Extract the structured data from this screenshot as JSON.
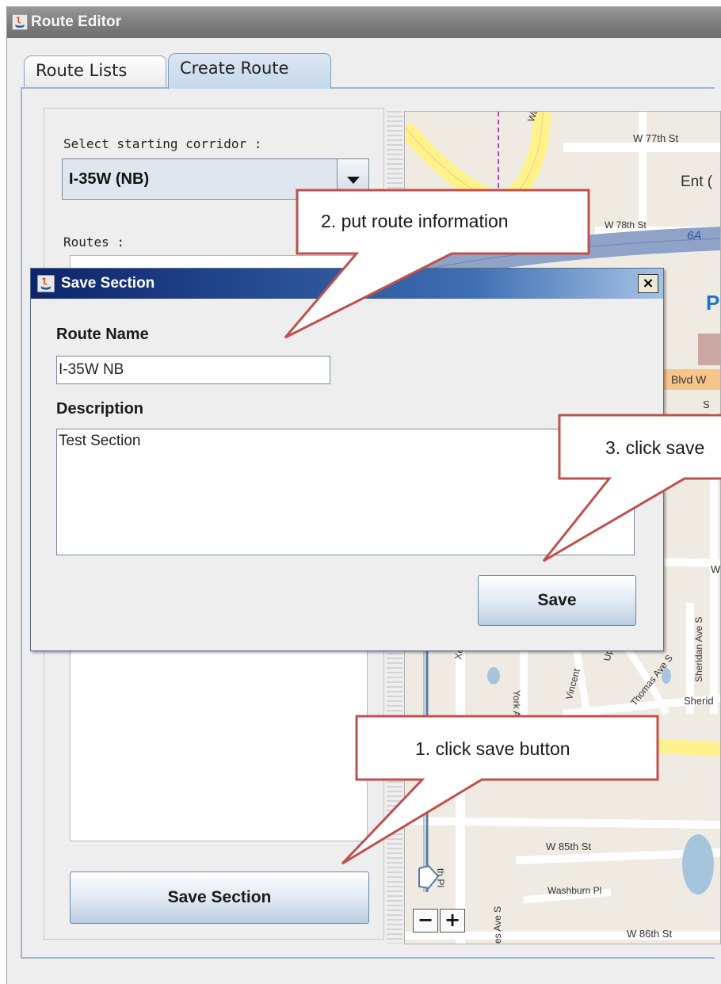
{
  "window": {
    "title": "Route Editor"
  },
  "tabs": [
    {
      "label": "Route Lists"
    },
    {
      "label": "Create Route"
    }
  ],
  "left_panel": {
    "corridor_label": "Select starting corridor :",
    "corridor_value": "I-35W (NB)",
    "routes_label": "Routes :",
    "save_section_label": "Save Section"
  },
  "map": {
    "labels": {
      "w77": "W 77th St",
      "ent": "Ent (",
      "w78": "W 78th St",
      "r6a": "6A",
      "blvd": "Blvd W",
      "washburn": "Washburn",
      "w": "W",
      "xerxes": "Xerxes A",
      "york": "York Ave S",
      "vincent": "Vincent",
      "upton": "Upt",
      "thomas": "Thomas Ave S",
      "sheridan": "Sheridan Ave S",
      "sherid": "Sherid",
      "s": "S",
      "p": "P",
      "w85": "W 85th St",
      "washburnpl": "Washburn Pl",
      "w86": "W 86th St",
      "ave_s": "es Ave S",
      "th_pl": "th Pl"
    },
    "zoom_out": "−",
    "zoom_in": "+"
  },
  "dialog": {
    "title": "Save Section",
    "close_label": "×",
    "route_name_label": "Route Name",
    "route_name_value": "I-35W NB",
    "description_label": "Description",
    "description_value": "Test Section",
    "save_label": "Save"
  },
  "callouts": {
    "step1": "1. click save button",
    "step2": "2. put route information",
    "step3": "3. click save"
  },
  "colors": {
    "callout_border": "#c0504d",
    "tab_active": "#c5d8ec",
    "titlebar": "#8a8a8a",
    "dialog_title": "#0c246a"
  }
}
